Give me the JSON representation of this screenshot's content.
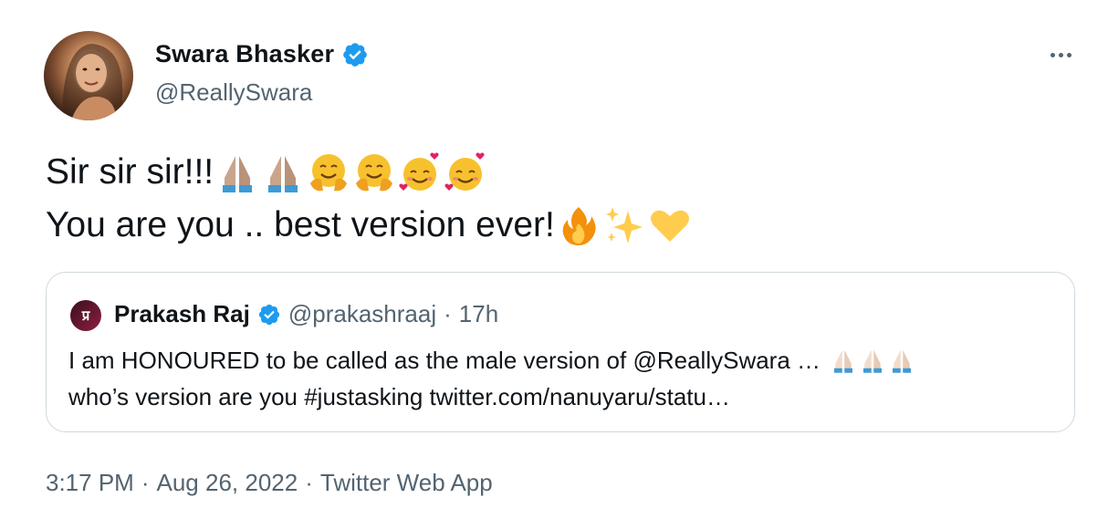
{
  "author": {
    "name": "Swara Bhasker",
    "handle": "@ReallySwara"
  },
  "tweet": {
    "line1_text": "Sir sir sir!!!",
    "line1_emoji": [
      "folded-hands-medium-skin",
      "folded-hands-medium-skin",
      "hugging-face",
      "hugging-face",
      "smiling-face-with-hearts",
      "smiling-face-with-hearts"
    ],
    "line2_text": "You are you .. best version ever!",
    "line2_emoji": [
      "fire",
      "sparkles",
      "yellow-heart"
    ]
  },
  "quoted_tweet": {
    "avatar_text": "प्र",
    "name": "Prakash Raj",
    "handle": "@prakashraaj",
    "separator": "·",
    "time": "17h",
    "line1": "I am HONOURED to be called as the male version of @ReallySwara …",
    "line1_emoji": [
      "folded-hands-light-skin",
      "folded-hands-light-skin",
      "folded-hands-light-skin"
    ],
    "line2": "who’s version are you #justasking twitter.com/nanuyaru/statu…"
  },
  "meta": {
    "time": "3:17 PM",
    "separator1": "·",
    "date": "Aug 26, 2022",
    "separator2": "·",
    "source": "Twitter Web App"
  },
  "colors": {
    "verified": "#1d9bf0",
    "secondary_text": "#536471",
    "border": "#cfd9de"
  }
}
